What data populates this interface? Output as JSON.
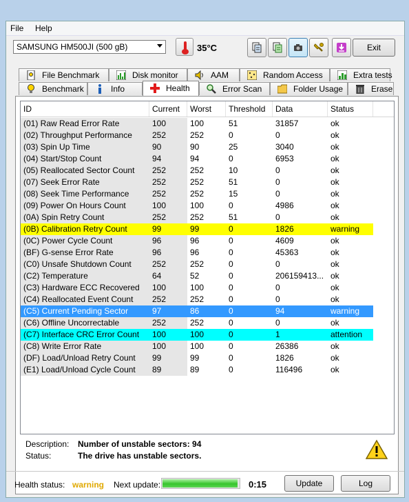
{
  "menu": [
    "File",
    "Help"
  ],
  "drive": {
    "selected": "SAMSUNG HM500JI (500 gB)"
  },
  "temperature": "35°C",
  "toolbar_icons": [
    "copy-icon",
    "copy-text-icon",
    "camera-icon",
    "wrench-icon",
    "save-icon"
  ],
  "exit_label": "Exit",
  "tabs_top": [
    {
      "label": "File Benchmark",
      "icon": "file-benchmark-icon"
    },
    {
      "label": "Disk monitor",
      "icon": "disk-monitor-icon"
    },
    {
      "label": "AAM",
      "icon": "speaker-icon"
    },
    {
      "label": "Random Access",
      "icon": "random-access-icon"
    },
    {
      "label": "Extra tests",
      "icon": "extra-tests-icon"
    }
  ],
  "tabs_bottom": [
    {
      "label": "Benchmark",
      "icon": "lightbulb-icon"
    },
    {
      "label": "Info",
      "icon": "info-icon"
    },
    {
      "label": "Health",
      "icon": "health-cross-icon"
    },
    {
      "label": "Error Scan",
      "icon": "magnifier-icon"
    },
    {
      "label": "Folder Usage",
      "icon": "folder-icon"
    },
    {
      "label": "Erase",
      "icon": "trash-icon"
    }
  ],
  "table": {
    "headers": [
      "ID",
      "Current",
      "Worst",
      "Threshold",
      "Data",
      "Status"
    ],
    "rows": [
      [
        "(01) Raw Read Error Rate",
        "100",
        "100",
        "51",
        "31857",
        "ok"
      ],
      [
        "(02) Throughput Performance",
        "252",
        "252",
        "0",
        "0",
        "ok"
      ],
      [
        "(03) Spin Up Time",
        "90",
        "90",
        "25",
        "3040",
        "ok"
      ],
      [
        "(04) Start/Stop Count",
        "94",
        "94",
        "0",
        "6953",
        "ok"
      ],
      [
        "(05) Reallocated Sector Count",
        "252",
        "252",
        "10",
        "0",
        "ok"
      ],
      [
        "(07) Seek Error Rate",
        "252",
        "252",
        "51",
        "0",
        "ok"
      ],
      [
        "(08) Seek Time Performance",
        "252",
        "252",
        "15",
        "0",
        "ok"
      ],
      [
        "(09) Power On Hours Count",
        "100",
        "100",
        "0",
        "4986",
        "ok"
      ],
      [
        "(0A) Spin Retry Count",
        "252",
        "252",
        "51",
        "0",
        "ok"
      ],
      [
        "(0B) Calibration Retry Count",
        "99",
        "99",
        "0",
        "1826",
        "warning"
      ],
      [
        "(0C) Power Cycle Count",
        "96",
        "96",
        "0",
        "4609",
        "ok"
      ],
      [
        "(BF) G-sense Error Rate",
        "96",
        "96",
        "0",
        "45363",
        "ok"
      ],
      [
        "(C0) Unsafe Shutdown Count",
        "252",
        "252",
        "0",
        "0",
        "ok"
      ],
      [
        "(C2) Temperature",
        "64",
        "52",
        "0",
        "206159413...",
        "ok"
      ],
      [
        "(C3) Hardware ECC Recovered",
        "100",
        "100",
        "0",
        "0",
        "ok"
      ],
      [
        "(C4) Reallocated Event Count",
        "252",
        "252",
        "0",
        "0",
        "ok"
      ],
      [
        "(C5) Current Pending Sector",
        "97",
        "86",
        "0",
        "94",
        "warning"
      ],
      [
        "(C6) Offline Uncorrectable",
        "252",
        "252",
        "0",
        "0",
        "ok"
      ],
      [
        "(C7) Interface CRC Error Count",
        "100",
        "100",
        "0",
        "1",
        "attention"
      ],
      [
        "(C8) Write Error Rate",
        "100",
        "100",
        "0",
        "26386",
        "ok"
      ],
      [
        "(DF) Load/Unload Retry Count",
        "99",
        "99",
        "0",
        "1826",
        "ok"
      ],
      [
        "(E1) Load/Unload Cycle Count",
        "89",
        "89",
        "0",
        "116496",
        "ok"
      ]
    ],
    "highlight_colors": {
      "warning": "#ffff00",
      "selected": "#3399ff",
      "attention": "#00ffff"
    }
  },
  "description": {
    "label": "Description:",
    "value": "Number of unstable sectors: 94"
  },
  "status": {
    "label": "Status:",
    "value": "The drive has unstable sectors."
  },
  "footer": {
    "health_label": "Health status:",
    "health_value": "warning",
    "health_color": "#e0a800",
    "next_update_label": "Next update:",
    "progress": 0.98,
    "timer": "0:15",
    "update_label": "Update",
    "log_label": "Log"
  }
}
